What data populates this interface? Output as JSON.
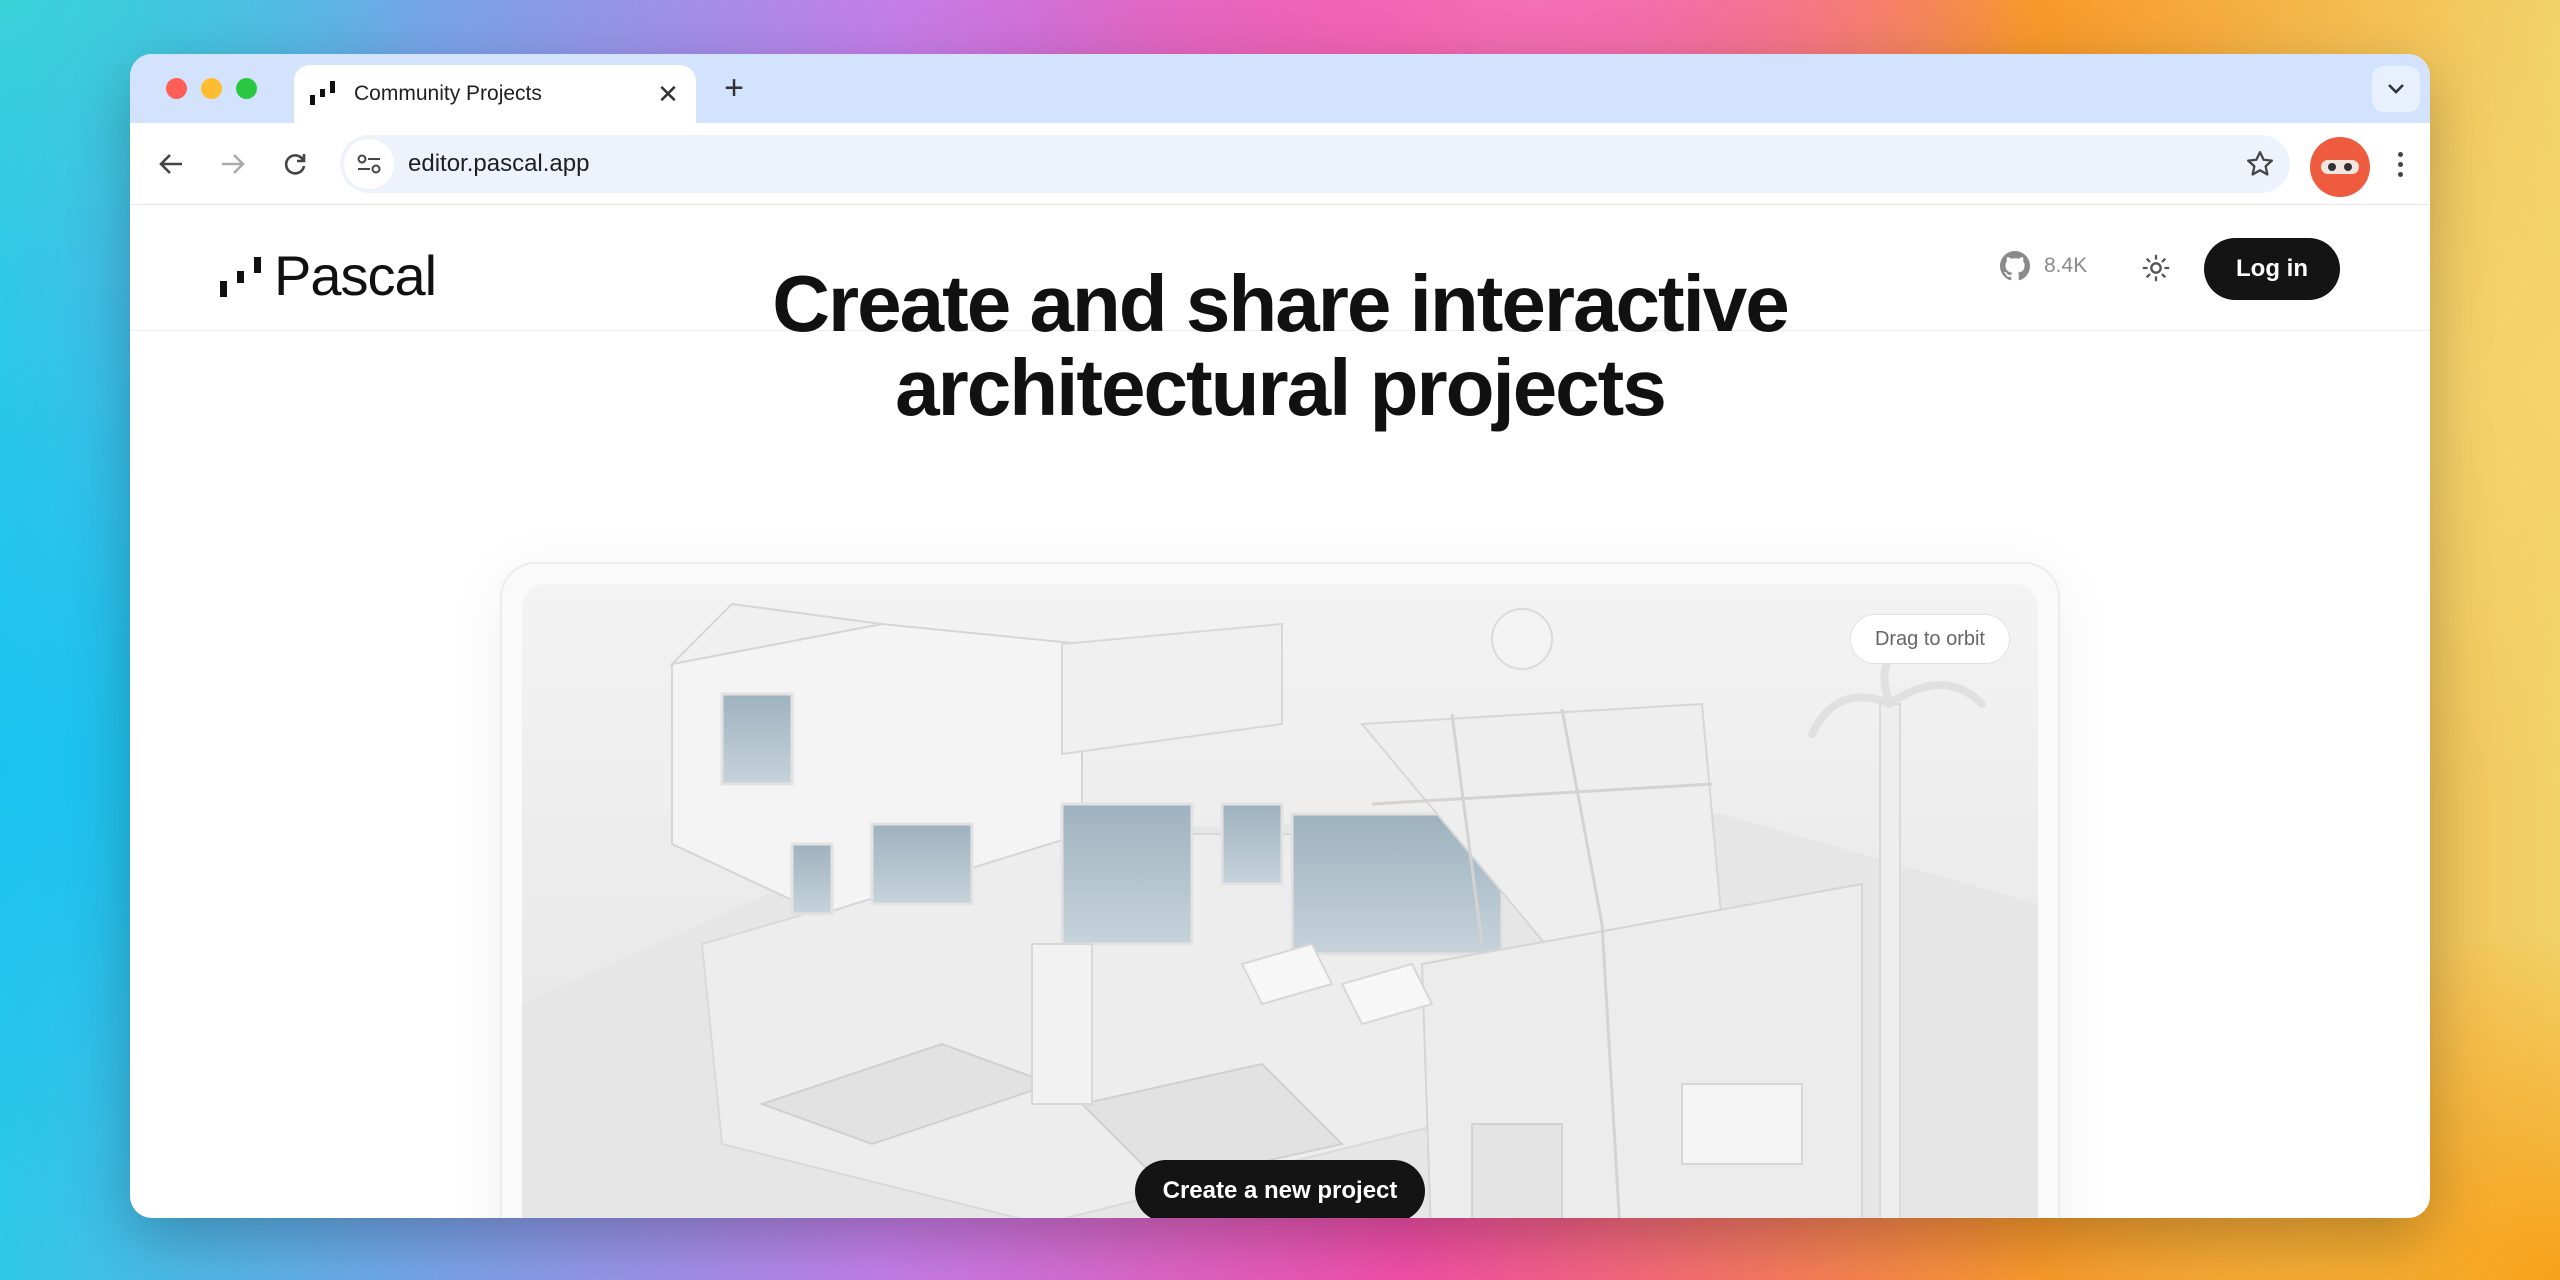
{
  "browser": {
    "tab_title": "Community Projects",
    "url": "editor.pascal.app"
  },
  "site": {
    "brand": "Pascal",
    "github_stars": "8.4K",
    "login_label": "Log in"
  },
  "hero": {
    "line1": "Create and share interactive",
    "line2": "architectural projects"
  },
  "preview": {
    "orbit_hint": "Drag to orbit",
    "cta_label": "Create a new project"
  },
  "colors": {
    "accent_dark": "#141414",
    "profile": "#ef5b3f",
    "tabbar": "#d3e3fd"
  }
}
